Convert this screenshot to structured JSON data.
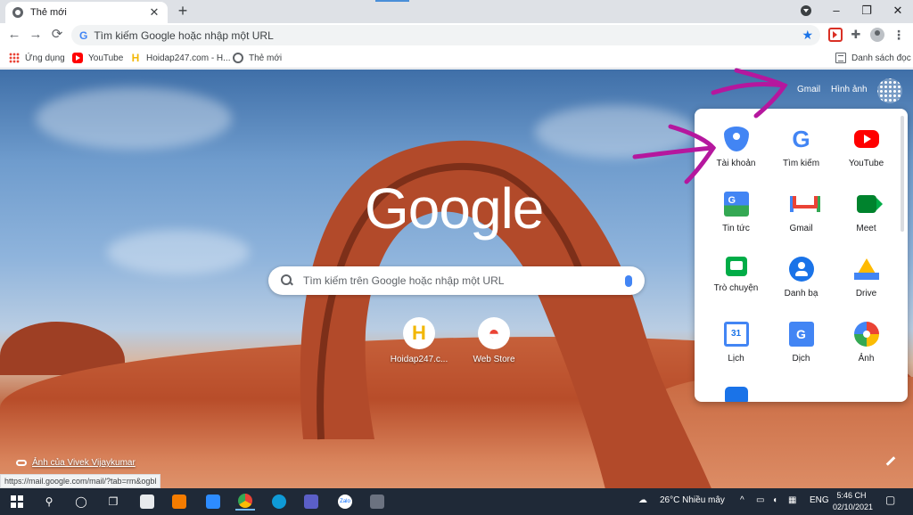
{
  "browser": {
    "tab_title": "Thẻ mới",
    "tab_close": "✕",
    "new_tab": "+",
    "address_placeholder": "Tìm kiếm Google hoặc nhập một URL",
    "address_g": "G",
    "back": "←",
    "forward": "→",
    "reload": "⟳",
    "star": "★",
    "extensions_icon": "✚",
    "menu_icon": "⋮",
    "minimize": "–",
    "restore": "❐",
    "close_window": "✕"
  },
  "bookmarks": {
    "items": [
      {
        "label": "Ứng dụng",
        "icon": "apps-grid-icon"
      },
      {
        "label": "YouTube",
        "icon": "youtube-icon"
      },
      {
        "label": "Hoidap247.com - H...",
        "icon": "hoidap247-icon"
      },
      {
        "label": "Thẻ mới",
        "icon": "globe-icon"
      }
    ],
    "reading_list": "Danh sách đọc",
    "h_glyph": "H"
  },
  "newtab": {
    "gmail": "Gmail",
    "images": "Hình ảnh",
    "logo": "Google",
    "search_placeholder": "Tìm kiếm trên Google hoặc nhập một URL",
    "shortcuts": [
      {
        "label": "Hoidap247.c...",
        "glyph": "H",
        "color": "#f2b705"
      },
      {
        "label": "Web Store",
        "glyph": "◓",
        "color": "#ea4335"
      }
    ],
    "photo_credit": "Ảnh của Vivek Vijaykumar"
  },
  "apps_panel": {
    "apps": [
      {
        "label": "Tài khoản",
        "icon": "account-icon",
        "cls": "account",
        "glyph": ""
      },
      {
        "label": "Tìm kiếm",
        "icon": "google-search-icon",
        "cls": "gsearch",
        "glyph": "G"
      },
      {
        "label": "YouTube",
        "icon": "youtube-icon",
        "cls": "youtube",
        "glyph": ""
      },
      {
        "label": "Tin tức",
        "icon": "news-icon",
        "cls": "news",
        "glyph": ""
      },
      {
        "label": "Gmail",
        "icon": "gmail-icon",
        "cls": "gmail",
        "glyph": ""
      },
      {
        "label": "Meet",
        "icon": "meet-icon",
        "cls": "meet",
        "glyph": ""
      },
      {
        "label": "Trò chuyện",
        "icon": "chat-icon",
        "cls": "chat",
        "glyph": ""
      },
      {
        "label": "Danh bạ",
        "icon": "contacts-icon",
        "cls": "contacts",
        "glyph": ""
      },
      {
        "label": "Drive",
        "icon": "drive-icon",
        "cls": "drive",
        "glyph": ""
      },
      {
        "label": "Lịch",
        "icon": "calendar-icon",
        "cls": "calendar",
        "glyph": "31"
      },
      {
        "label": "Dịch",
        "icon": "translate-icon",
        "cls": "translate",
        "glyph": "G"
      },
      {
        "label": "Ảnh",
        "icon": "photos-icon",
        "cls": "photos",
        "glyph": ""
      },
      {
        "label": "",
        "icon": "duo-icon",
        "cls": "duo",
        "glyph": ""
      }
    ]
  },
  "status_bar": {
    "url": "https://mail.google.com/mail/?tab=rm&ogbl"
  },
  "taskbar": {
    "weather": "26°C  Nhiều mây",
    "language": "ENG",
    "time": "5:46 CH",
    "date": "02/10/2021",
    "tray_up": "^",
    "zalo": "Zalo"
  },
  "colors": {
    "annotation": "#b5179e",
    "accent": "#1a73e8"
  }
}
